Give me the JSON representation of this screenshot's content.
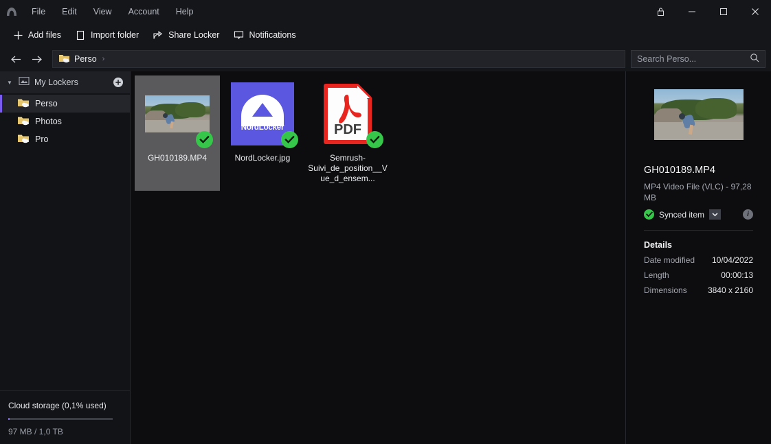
{
  "window": {
    "logo_icon": "nordlocker-logo-icon",
    "menu": [
      "File",
      "Edit",
      "View",
      "Account",
      "Help"
    ],
    "controls": {
      "lock": "lock-icon",
      "minimize": "minimize-icon",
      "maximize": "maximize-icon",
      "close": "close-icon"
    }
  },
  "toolbar": {
    "buttons": [
      {
        "label": "Add files",
        "icon": "plus-icon"
      },
      {
        "label": "Import folder",
        "icon": "folder-import-icon"
      },
      {
        "label": "Share Locker",
        "icon": "share-icon"
      },
      {
        "label": "Notifications",
        "icon": "notification-bubble-icon"
      }
    ]
  },
  "navbar": {
    "back_icon": "arrow-left-icon",
    "forward_icon": "arrow-right-icon",
    "breadcrumb": {
      "label": "Perso",
      "icon": "folder-cloud-icon",
      "separator": "›"
    },
    "search": {
      "placeholder": "Search Perso...",
      "value": "",
      "icon": "search-icon"
    }
  },
  "sidebar": {
    "header": {
      "label": "My Lockers",
      "icon": "locker-icon",
      "caret": "▼",
      "add_icon": "plus-circle-icon"
    },
    "items": [
      {
        "label": "Perso",
        "icon": "folder-cloud-icon",
        "selected": true
      },
      {
        "label": "Photos",
        "icon": "folder-cloud-icon",
        "selected": false
      },
      {
        "label": "Pro",
        "icon": "folder-cloud-icon",
        "selected": false
      }
    ],
    "storage": {
      "title": "Cloud storage (0,1% used)",
      "usage": "97 MB / 1,0 TB",
      "percent": 0.1
    }
  },
  "files": [
    {
      "name": "GH010189.MP4",
      "type": "video",
      "selected": true,
      "badge": "synced-check-icon"
    },
    {
      "name": "NordLocker.jpg",
      "type": "image",
      "selected": false,
      "badge": "synced-check-icon",
      "brand_text": "NordLocker"
    },
    {
      "name": "Semrush-Suivi_de_position__Vue_d_ensem...",
      "type": "pdf",
      "selected": false,
      "badge": "synced-check-icon",
      "pdf_label": "PDF"
    }
  ],
  "details": {
    "thumbnail_icon": "video-thumbnail",
    "title": "GH010189.MP4",
    "subtitle": "MP4 Video File (VLC) - 97,28 MB",
    "sync_status": "Synced item",
    "sync_icon": "synced-check-icon",
    "caret_icon": "chevron-down-icon",
    "info_icon": "info-icon",
    "section_title": "Details",
    "rows": [
      {
        "key": "Date modified",
        "value": "10/04/2022"
      },
      {
        "key": "Length",
        "value": "00:00:13"
      },
      {
        "key": "Dimensions",
        "value": "3840 x 2160"
      }
    ]
  },
  "colors": {
    "accent": "#7a5cf0",
    "sync_green": "#35c64a",
    "nordlocker_blue": "#5b57e0",
    "pdf_red": "#e8251f",
    "titlebar": "#15161a",
    "background": "#0d0d0f"
  }
}
